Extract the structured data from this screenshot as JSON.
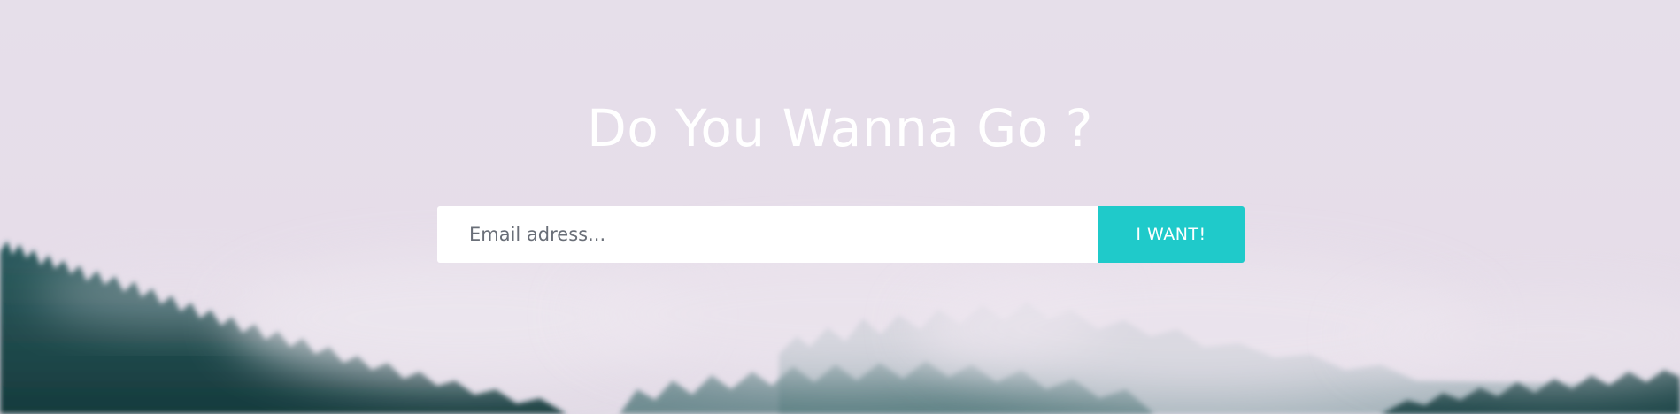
{
  "hero": {
    "title": "Do You Wanna Go ?",
    "background_icon": "misty-forest-photo"
  },
  "signup": {
    "email_placeholder": "Email adress...",
    "email_value": "",
    "submit_label": "I WANT!"
  },
  "colors": {
    "sky": "#e6dfea",
    "forest_dark": "#1f4a4c",
    "forest_mid": "#3a6b6d",
    "button_accent": "#1fcaca",
    "title_text": "#ffffff",
    "input_background": "#ffffff",
    "placeholder_text": "#6a6f78"
  }
}
